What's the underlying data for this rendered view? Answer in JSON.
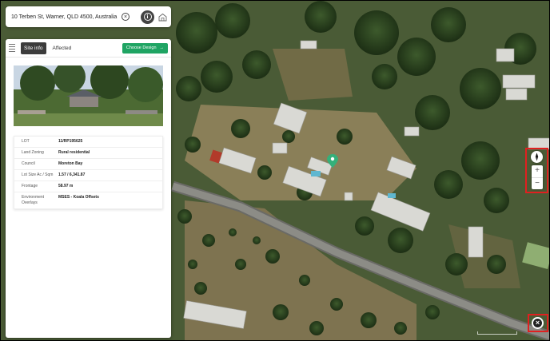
{
  "search": {
    "address": "10 Terben St, Warner, QLD 4500, Australia",
    "clear_symbol": "×",
    "info_symbol": "i"
  },
  "panel": {
    "tabs": [
      {
        "label": "Site info",
        "active": true
      },
      {
        "label": "Affected",
        "active": false
      }
    ],
    "choose_design_label": "Choose Design",
    "choose_design_arrow": "→",
    "details": [
      {
        "label": "LOT",
        "value": "11/RP195625"
      },
      {
        "label": "Land Zoning",
        "value": "Rural residential"
      },
      {
        "label": "Council",
        "value": "Moreton Bay"
      },
      {
        "label": "Lot Size Ac / Sqm",
        "value": "1.57 / 6,341.87"
      },
      {
        "label": "Frontage",
        "value": "58.97 m"
      },
      {
        "label": "Environment Overlays",
        "value": "MSES - Koala Offsets"
      }
    ]
  },
  "map_controls": {
    "zoom_in": "+",
    "zoom_out": "−",
    "close_symbol": "×"
  },
  "colors": {
    "accent_green": "#1fa463",
    "highlight_red": "#e02020",
    "active_tab": "#3c3c3c"
  }
}
